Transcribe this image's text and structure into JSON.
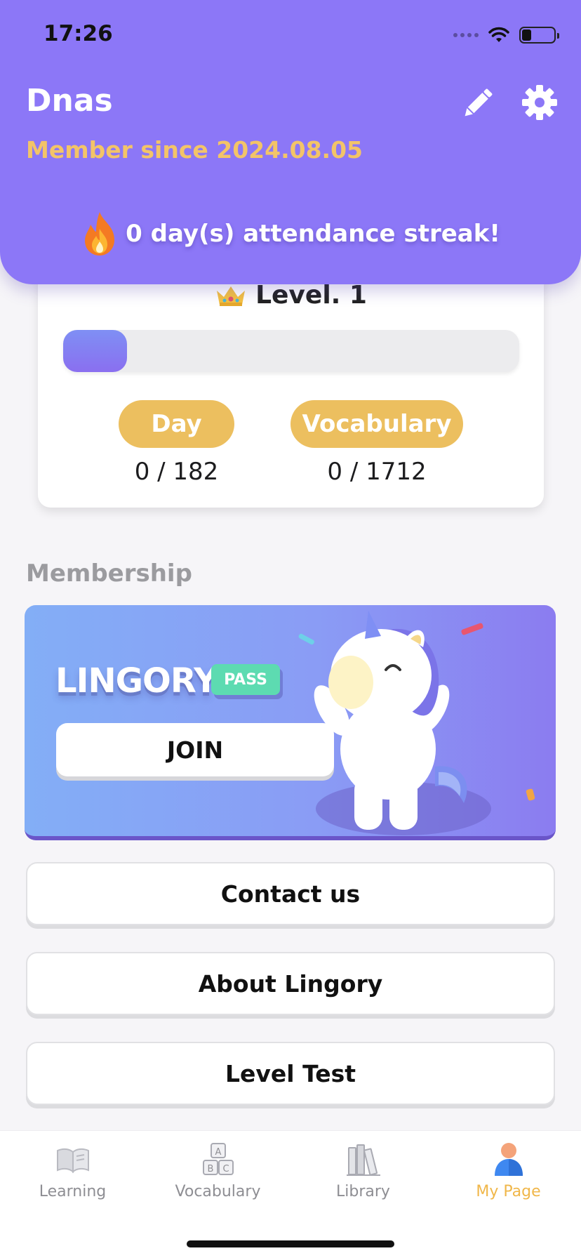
{
  "status_bar": {
    "time": "17:26"
  },
  "header": {
    "user_name": "Dnas",
    "member_since": "Member since 2024.08.05",
    "streak_text": "0 day(s) attendance streak!"
  },
  "level_card": {
    "level_label": "Level. 1",
    "progress_fraction": 0.14,
    "stats": {
      "day": {
        "label": "Day",
        "value": "0 / 182"
      },
      "vocabulary": {
        "label": "Vocabulary",
        "value": "0 / 1712"
      }
    }
  },
  "membership": {
    "section_title": "Membership",
    "brand": "LINGORY",
    "badge": "PASS",
    "join_label": "JOIN"
  },
  "menu": {
    "contact": "Contact us",
    "about": "About Lingory",
    "level_test": "Level Test"
  },
  "bottom_nav": {
    "items": [
      {
        "label": "Learning",
        "icon": "book-icon"
      },
      {
        "label": "Vocabulary",
        "icon": "abc-blocks-icon"
      },
      {
        "label": "Library",
        "icon": "bookshelf-icon"
      },
      {
        "label": "My Page",
        "icon": "person-icon"
      }
    ],
    "active_index": 3
  },
  "colors": {
    "header": "#8c77f7",
    "accent_gold": "#ecbf5f",
    "member_since": "#f3c468",
    "pass_badge": "#5ddbb1",
    "nav_active": "#f0b74a"
  }
}
